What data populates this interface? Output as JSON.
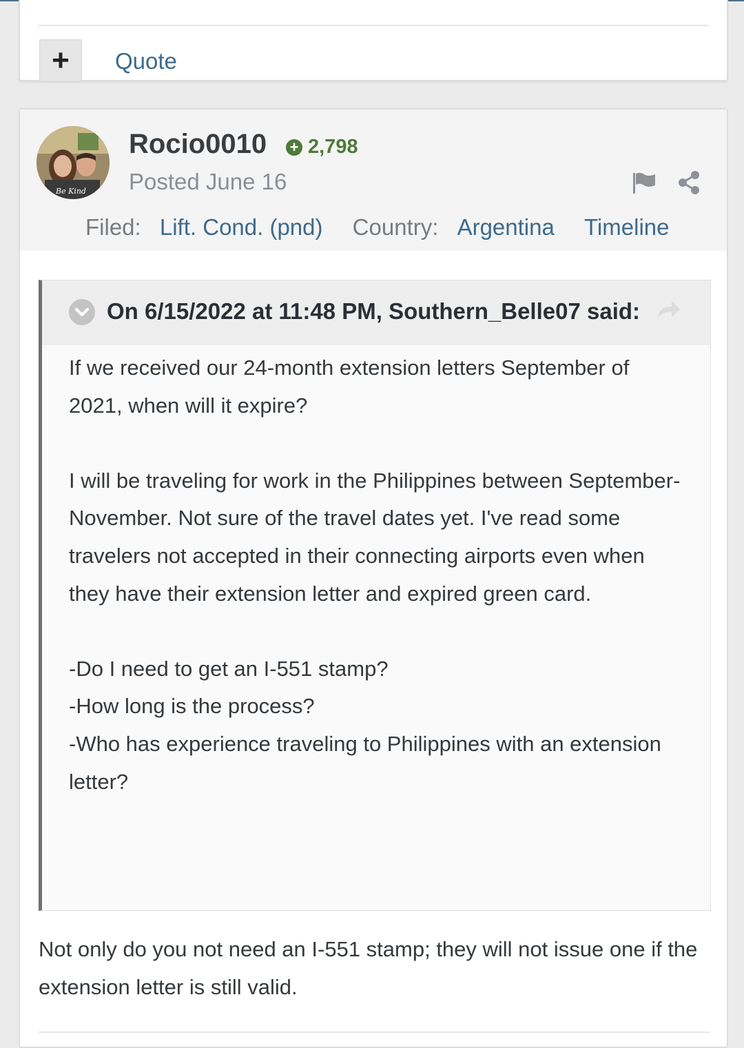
{
  "previous_post": {
    "plus_label": "+",
    "quote_label": "Quote"
  },
  "post": {
    "username": "Rocio0010",
    "reputation": "2,798",
    "posted": "Posted June 16",
    "avatar_text": "Be Kind",
    "meta": {
      "filed_label": "Filed:",
      "filed_value": "Lift. Cond. (pnd)",
      "country_label": "Country:",
      "country_value": "Argentina",
      "timeline_label": "Timeline"
    },
    "quote": {
      "citation": "On 6/15/2022 at 11:48 PM, Southern_Belle07 said:",
      "paragraphs": [
        "If we received our 24-month extension letters September of 2021, when will it expire?",
        "",
        "I will be traveling for work in the Philippines between September- November. Not sure of the travel dates yet. I've read some travelers not accepted in their connecting airports even when they have their extension letter and expired green card.",
        "",
        "-Do I need to get an I-551 stamp?",
        "-How long is the process?",
        "-Who has experience traveling to Philippines with an extension letter?"
      ]
    },
    "reply": "Not only do you not need an I-551 stamp; they will not issue one if the extension letter is still valid."
  },
  "colors": {
    "link": "#3d6a8c",
    "reputation": "#4f7a3a",
    "quote_border": "#707070"
  },
  "icons": [
    "plus-icon",
    "reputation-plus-icon",
    "flag-icon",
    "share-icon",
    "collapse-chevron-icon",
    "goto-quote-icon"
  ]
}
